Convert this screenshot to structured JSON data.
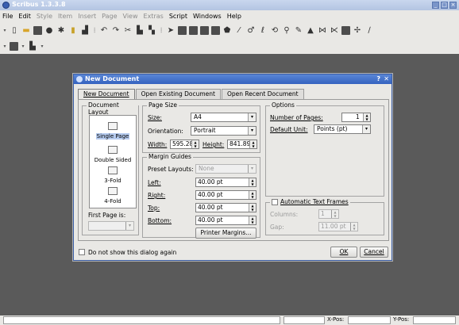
{
  "app": {
    "title": "Scribus 1.3.3.8"
  },
  "menu": [
    {
      "label": "File",
      "disabled": false
    },
    {
      "label": "Edit",
      "disabled": false
    },
    {
      "label": "Style",
      "disabled": true
    },
    {
      "label": "Item",
      "disabled": true
    },
    {
      "label": "Insert",
      "disabled": true
    },
    {
      "label": "Page",
      "disabled": true
    },
    {
      "label": "View",
      "disabled": true
    },
    {
      "label": "Extras",
      "disabled": true
    },
    {
      "label": "Script",
      "disabled": false
    },
    {
      "label": "Windows",
      "disabled": false
    },
    {
      "label": "Help",
      "disabled": false
    }
  ],
  "dialog": {
    "title": "New Document",
    "help": "?",
    "close": "✕",
    "tabs": [
      "New Document",
      "Open Existing Document",
      "Open Recent Document"
    ],
    "document_layout": {
      "legend": "Document Layout",
      "items": [
        "Single Page",
        "Double Sided",
        "3-Fold",
        "4-Fold"
      ],
      "selected": "Single Page",
      "first_page_label": "First Page is:"
    },
    "page_size": {
      "legend": "Page Size",
      "size_label": "Size:",
      "size_value": "A4",
      "orientation_label": "Orientation:",
      "orientation_value": "Portrait",
      "width_label": "Width:",
      "width_value": "595.28",
      "height_label": "Height:",
      "height_value": "841.89"
    },
    "margin_guides": {
      "legend": "Margin Guides",
      "preset_label": "Preset Layouts:",
      "preset_value": "None",
      "left_label": "Left:",
      "left_value": "40.00 pt",
      "right_label": "Right:",
      "right_value": "40.00 pt",
      "top_label": "Top:",
      "top_value": "40.00 pt",
      "bottom_label": "Bottom:",
      "bottom_value": "40.00 pt",
      "printer_margins_button": "Printer Margins..."
    },
    "options": {
      "legend": "Options",
      "pages_label": "Number of Pages:",
      "pages_value": "1",
      "unit_label": "Default Unit:",
      "unit_value": "Points (pt)"
    },
    "auto_frames": {
      "legend": "Automatic Text Frames",
      "columns_label": "Columns:",
      "columns_value": "1",
      "gap_label": "Gap:",
      "gap_value": "11.00 pt"
    },
    "dont_show_label": "Do not show this dialog again",
    "ok_button": "OK",
    "cancel_button": "Cancel"
  },
  "status": {
    "xpos_label": "X-Pos:",
    "ypos_label": "Y-Pos:"
  }
}
